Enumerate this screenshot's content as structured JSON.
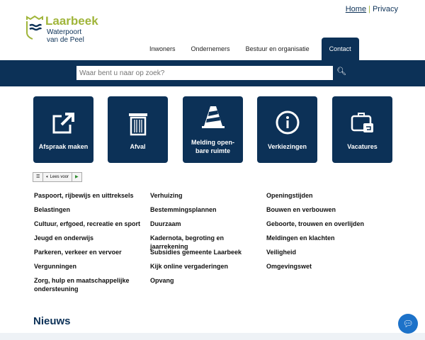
{
  "header": {
    "links": [
      "Home",
      "Privacy"
    ],
    "logo": {
      "name": "Laarbeek",
      "tagline1": "Waterpoort",
      "tagline2": "van de Peel"
    }
  },
  "nav": [
    "Inwoners",
    "Ondernemers",
    "Bestuur en organisatie",
    "Contact"
  ],
  "search": {
    "placeholder": "Waar bent u naar op zoek?",
    "icon": "search-icon"
  },
  "tiles": [
    "Afspraak maken",
    "Afval",
    "Melding open-bare ruimte",
    "Verkiezingen",
    "Vacatures"
  ],
  "reader": {
    "label": "Lees voor"
  },
  "links": {
    "col1": [
      "Paspoort, rijbewijs en uittreksels",
      "Belastingen",
      "Cultuur, erfgoed, recreatie en sport",
      "Jeugd en onderwijs",
      "Parkeren, verkeer en vervoer",
      "Vergunningen",
      "Zorg, hulp en maatschappelijke ondersteuning"
    ],
    "col2": [
      "Verhuizing",
      "Bestemmingsplannen",
      "Duurzaam",
      "Kadernota, begroting en jaarrekening",
      "Subsidies gemeente Laarbeek",
      "Kijk online vergaderingen",
      "Opvang"
    ],
    "col3": [
      "Openingstijden",
      "Bouwen en verbouwen",
      "Geboorte, trouwen en overlijden",
      "Meldingen en klachten",
      "Veiligheid",
      "Omgevingswet"
    ]
  },
  "news": {
    "title": "Nieuws"
  },
  "colors": {
    "navy": "#0c3157",
    "green": "#a0b53a"
  }
}
